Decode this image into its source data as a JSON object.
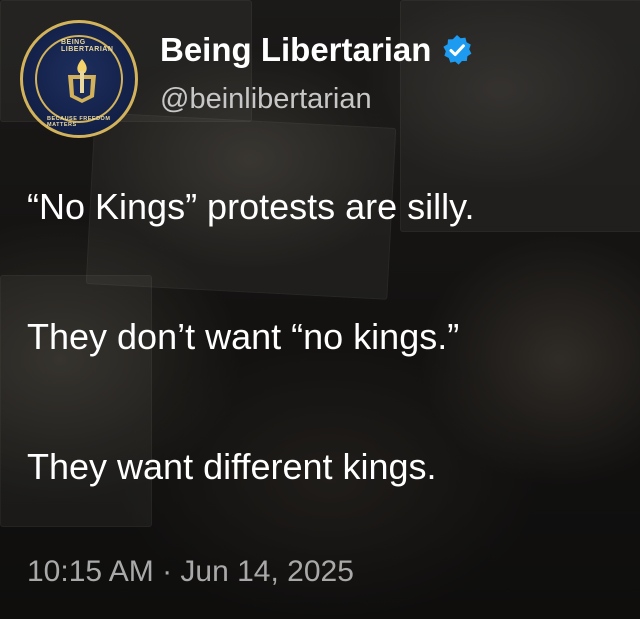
{
  "author": {
    "display_name": "Being Libertarian",
    "handle": "@beinlibertarian",
    "avatar_top_text": "BEING LIBERTARIAN",
    "avatar_bottom_text": "BECAUSE FREEDOM MATTERS",
    "verified_icon": "verified-badge-icon",
    "verified_color": "#1d9bf0"
  },
  "tweet": {
    "lines": [
      "“No Kings” protests are silly.",
      "They don’t want “no kings.”",
      "They want different kings."
    ],
    "timestamp": "10:15 AM · Jun 14, 2025"
  },
  "colors": {
    "text_primary": "#ffffff",
    "text_secondary": "#c7c7c7",
    "timestamp": "#a9a9a9",
    "avatar_gold": "#d2b25a",
    "avatar_navy": "#14224a"
  }
}
